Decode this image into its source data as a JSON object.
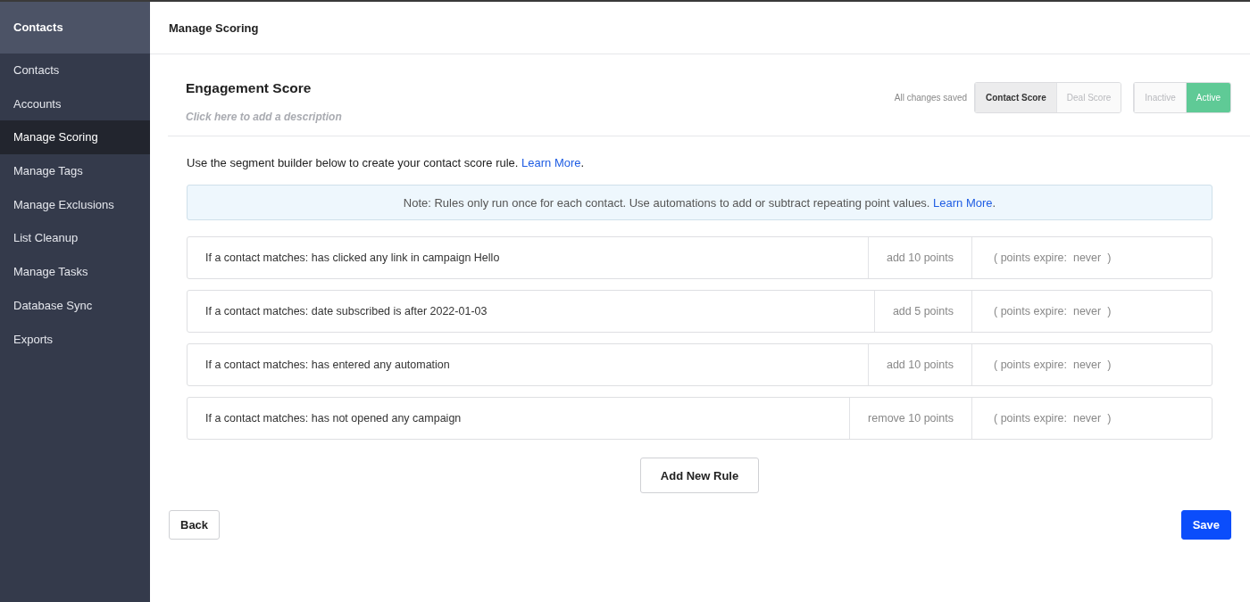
{
  "sidebar": {
    "title": "Contacts",
    "items": [
      {
        "label": "Contacts",
        "selected": false
      },
      {
        "label": "Accounts",
        "selected": false
      },
      {
        "label": "Manage Scoring",
        "selected": true
      },
      {
        "label": "Manage Tags",
        "selected": false
      },
      {
        "label": "Manage Exclusions",
        "selected": false
      },
      {
        "label": "List Cleanup",
        "selected": false
      },
      {
        "label": "Manage Tasks",
        "selected": false
      },
      {
        "label": "Database Sync",
        "selected": false
      },
      {
        "label": "Exports",
        "selected": false
      }
    ]
  },
  "header": {
    "title": "Manage Scoring"
  },
  "score": {
    "name": "Engagement Score",
    "description_placeholder": "Click here to add a description",
    "save_status": "All changes saved",
    "score_type": [
      {
        "label": "Contact Score",
        "selected": true
      },
      {
        "label": "Deal Score",
        "selected": false
      }
    ],
    "status": [
      {
        "label": "Inactive",
        "selected": false
      },
      {
        "label": "Active",
        "selected": true
      }
    ]
  },
  "intro": {
    "text": "Use the segment builder below to create your contact score rule.",
    "link": "Learn More",
    "after": "."
  },
  "note": {
    "text": "Note: Rules only run once for each contact. Use automations to add or subtract repeating point values.",
    "link": "Learn More",
    "after": "."
  },
  "rules": [
    {
      "condition": "If a contact matches: has clicked any link in campaign Hello",
      "points": "add 10 points",
      "expiry": "( points expire:  never  )"
    },
    {
      "condition": "If a contact matches: date subscribed is after 2022-01-03",
      "points": "add 5 points",
      "expiry": "( points expire:  never  )"
    },
    {
      "condition": "If a contact matches: has entered any automation",
      "points": "add 10 points",
      "expiry": "( points expire:  never  )"
    },
    {
      "condition": "If a contact matches: has not opened any campaign",
      "points": "remove 10 points",
      "expiry": "( points expire:  never  )"
    }
  ],
  "buttons": {
    "add_rule": "Add New Rule",
    "back": "Back",
    "save": "Save"
  }
}
